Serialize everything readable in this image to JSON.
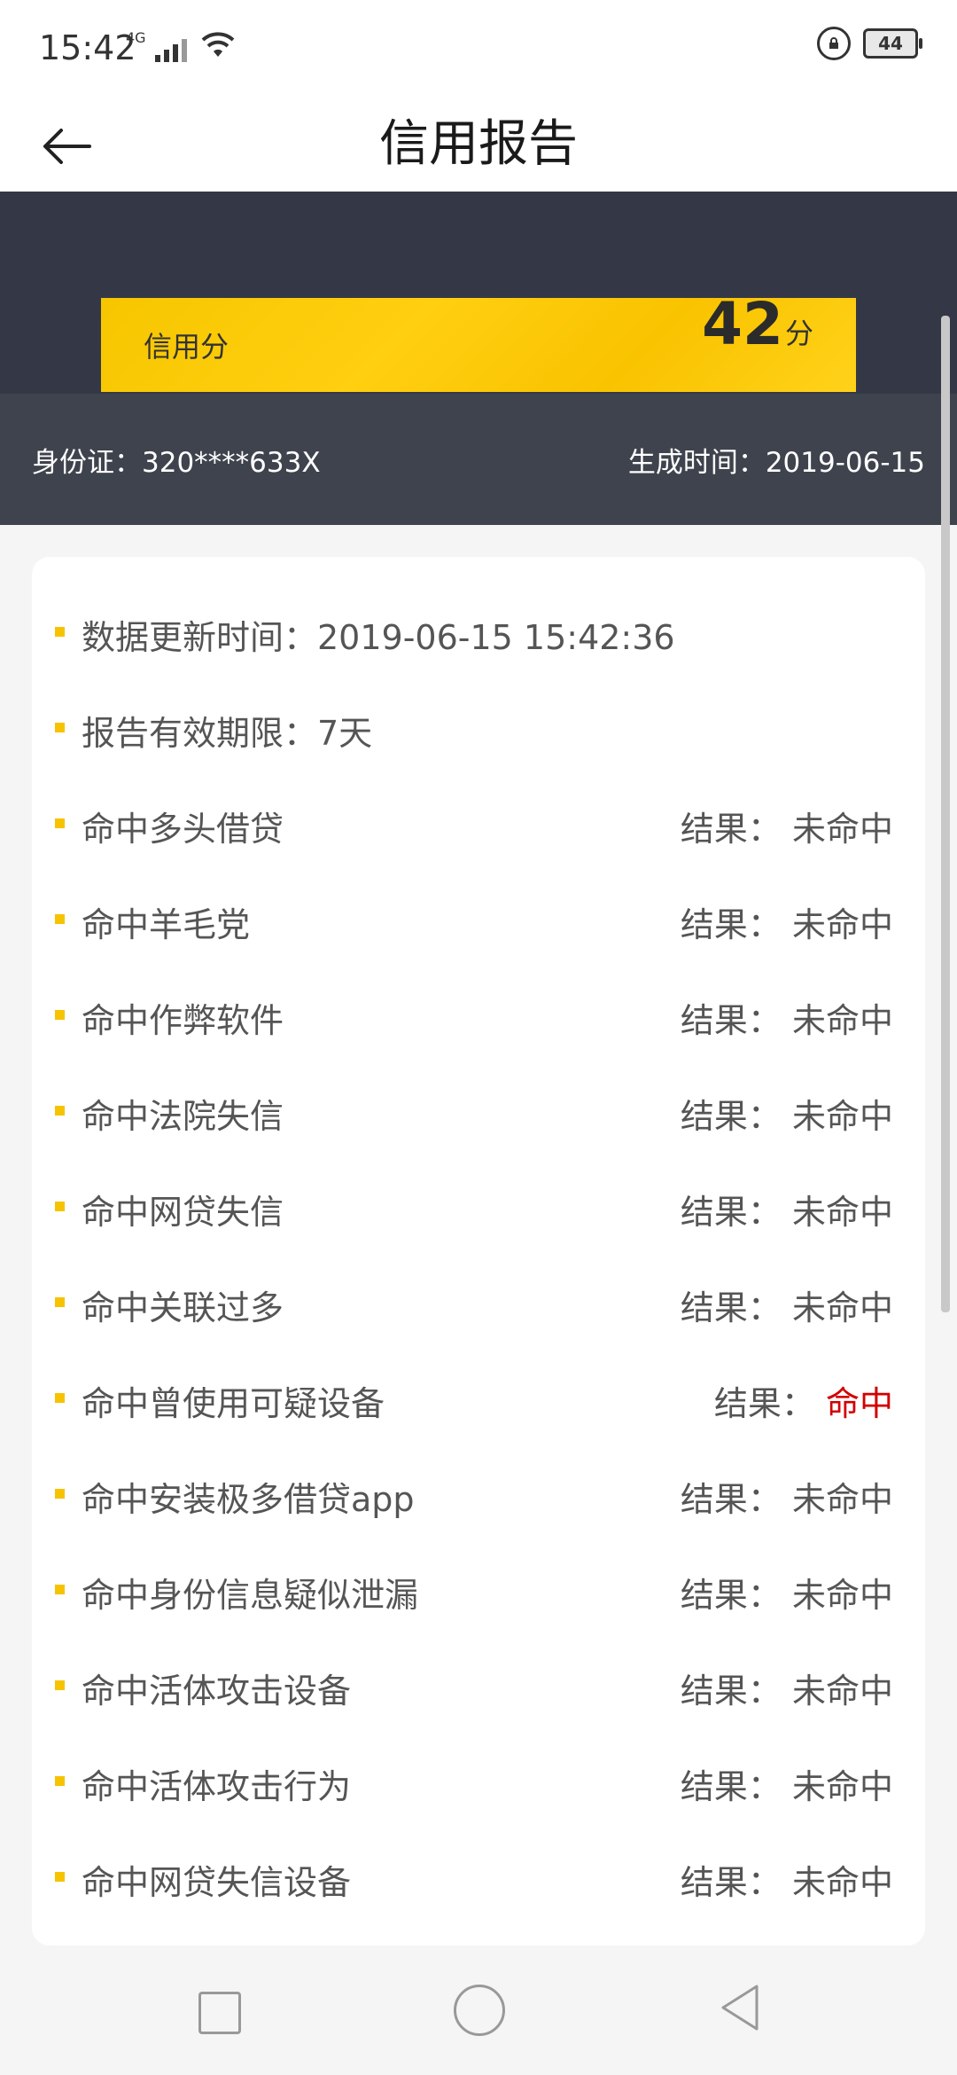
{
  "status": {
    "time": "15:42",
    "network": "4G",
    "battery": "44"
  },
  "header": {
    "title": "信用报告"
  },
  "score": {
    "label": "信用分",
    "value": "42",
    "unit": "分"
  },
  "info": {
    "id_text": "身份证：320****633X",
    "generated_text": "生成时间：2019-06-15"
  },
  "report": {
    "rows": [
      {
        "label": "数据更新时间：2019-06-15 15:42:36",
        "result_label": "",
        "result_value": ""
      },
      {
        "label": "报告有效期限：7天",
        "result_label": "",
        "result_value": ""
      },
      {
        "label": "命中多头借贷",
        "result_label": "结果：",
        "result_value": "未命中"
      },
      {
        "label": "命中羊毛党",
        "result_label": "结果：",
        "result_value": "未命中"
      },
      {
        "label": "命中作弊软件",
        "result_label": "结果：",
        "result_value": "未命中"
      },
      {
        "label": "命中法院失信",
        "result_label": "结果：",
        "result_value": "未命中"
      },
      {
        "label": "命中网贷失信",
        "result_label": "结果：",
        "result_value": "未命中"
      },
      {
        "label": "命中关联过多",
        "result_label": "结果：",
        "result_value": "未命中"
      },
      {
        "label": "命中曾使用可疑设备",
        "result_label": "结果：",
        "result_value": "命中"
      },
      {
        "label": "命中安装极多借贷app",
        "result_label": "结果：",
        "result_value": "未命中"
      },
      {
        "label": "命中身份信息疑似泄漏",
        "result_label": "结果：",
        "result_value": "未命中"
      },
      {
        "label": "命中活体攻击设备",
        "result_label": "结果：",
        "result_value": "未命中"
      },
      {
        "label": "命中活体攻击行为",
        "result_label": "结果：",
        "result_value": "未命中"
      },
      {
        "label": "命中网贷失信设备",
        "result_label": "结果：",
        "result_value": "未命中"
      }
    ]
  },
  "colors": {
    "accent": "#f5c300",
    "dark": "#343846",
    "hit": "#d20000"
  }
}
